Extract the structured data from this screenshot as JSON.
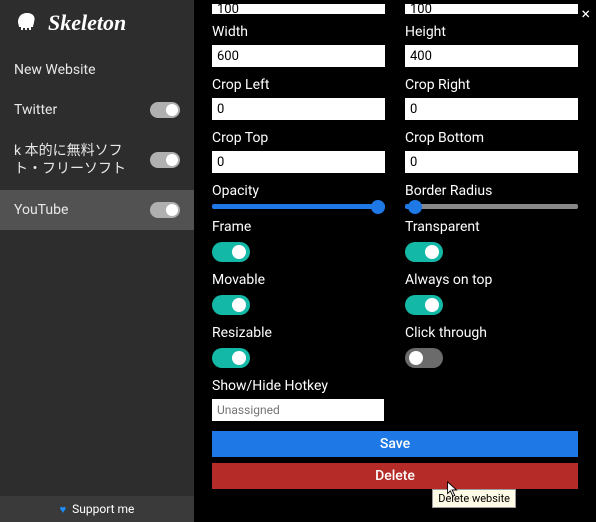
{
  "app": {
    "name": "Skeleton",
    "close": "×"
  },
  "sidebar": {
    "items": [
      {
        "label": "New Website",
        "toggle": null
      },
      {
        "label": "Twitter",
        "toggle": true
      },
      {
        "label": "k 本的に無料ソフト・フリーソフト",
        "toggle": true
      },
      {
        "label": "YouTube",
        "toggle": true
      }
    ],
    "support": "Support me"
  },
  "form": {
    "top_left_value": "100",
    "top_right_value": "100",
    "width": {
      "label": "Width",
      "value": "600"
    },
    "height": {
      "label": "Height",
      "value": "400"
    },
    "crop_left": {
      "label": "Crop Left",
      "value": "0"
    },
    "crop_right": {
      "label": "Crop Right",
      "value": "0"
    },
    "crop_top": {
      "label": "Crop Top",
      "value": "0"
    },
    "crop_bottom": {
      "label": "Crop Bottom",
      "value": "0"
    },
    "opacity": {
      "label": "Opacity",
      "value": 100
    },
    "border_radius": {
      "label": "Border Radius",
      "value": 2
    },
    "frame": {
      "label": "Frame",
      "value": true
    },
    "transparent": {
      "label": "Transparent",
      "value": true
    },
    "movable": {
      "label": "Movable",
      "value": true
    },
    "always_on_top": {
      "label": "Always on top",
      "value": true
    },
    "resizable": {
      "label": "Resizable",
      "value": true
    },
    "click_through": {
      "label": "Click through",
      "value": false
    },
    "hotkey": {
      "label": "Show/Hide Hotkey",
      "placeholder": "Unassigned"
    },
    "save": "Save",
    "delete": "Delete"
  },
  "tooltip": "Delete website"
}
